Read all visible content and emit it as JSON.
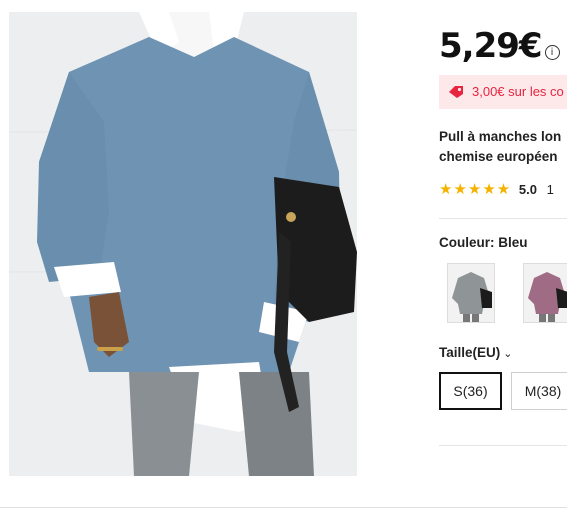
{
  "product": {
    "price": "5,29€",
    "info_icon": "i",
    "coupon_text": "3,00€ sur les co",
    "title_line1": "Pull à manches lon",
    "title_line2": "chemise européen",
    "rating_stars": "★★★★★",
    "rating_value": "5.0",
    "rating_count": "1"
  },
  "color": {
    "label": "Couleur: Bleu",
    "swatches": [
      {
        "name": "Gris",
        "hex": "#8f9497"
      },
      {
        "name": "Mauve",
        "hex": "#a06c85"
      }
    ]
  },
  "size": {
    "label": "Taille(EU)",
    "chevron": "⌄",
    "options": [
      "S(36)",
      "M(38)"
    ],
    "selected": "S(36)"
  },
  "colors": {
    "coupon_bg": "#fde8ea",
    "coupon_text": "#e8253f",
    "star": "#f5b301",
    "sweater": "#6e93b3"
  }
}
